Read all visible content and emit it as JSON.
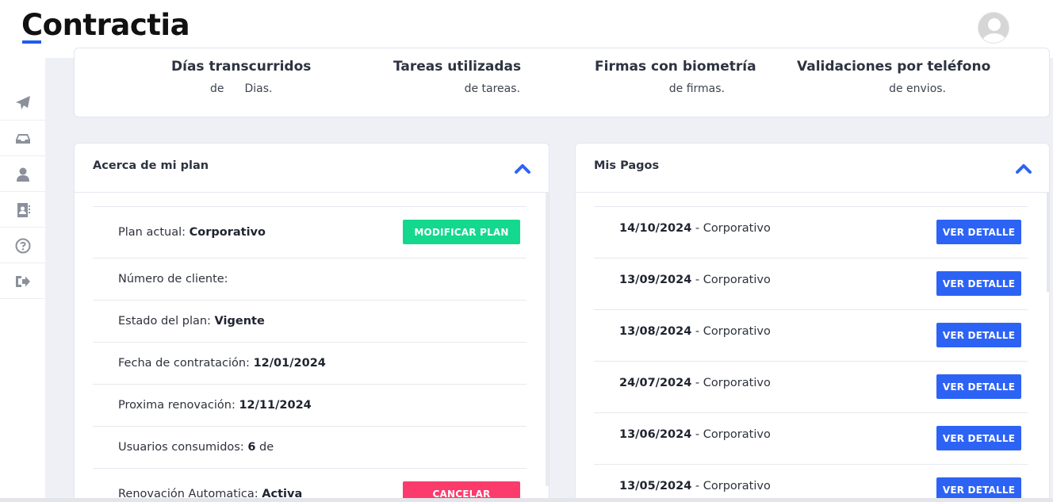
{
  "app": {
    "logo_text": "Contractia"
  },
  "sidebar": {
    "items": [
      {
        "icon": "send-icon",
        "label": ""
      },
      {
        "icon": "inbox-icon",
        "label": ""
      },
      {
        "icon": "user-icon",
        "label": ""
      },
      {
        "icon": "contacts-icon",
        "label": ""
      },
      {
        "icon": "help-icon",
        "label": ""
      },
      {
        "icon": "logout-icon",
        "label": ""
      }
    ]
  },
  "stats": [
    {
      "title": "Días transcurridos",
      "sub_prefix": "de",
      "sub_suffix": "Dias."
    },
    {
      "title": "Tareas utilizadas",
      "sub": "de tareas."
    },
    {
      "title": "Firmas con biometría",
      "sub": "de firmas."
    },
    {
      "title": "Validaciones por teléfono",
      "sub": "de envios."
    }
  ],
  "plan": {
    "title": "Acerca de mi plan",
    "rows": [
      {
        "label": "Plan actual: ",
        "value": "Corporativo"
      },
      {
        "label": "Número de cliente:",
        "value": ""
      },
      {
        "label": "Estado del plan: ",
        "value": "Vigente"
      },
      {
        "label": "Fecha de contratación: ",
        "value": "12/01/2024"
      },
      {
        "label": "Proxima renovación: ",
        "value": "12/11/2024"
      },
      {
        "label": "Usuarios consumidos: ",
        "value": "6",
        "suffix": " de"
      },
      {
        "label": "Renovación Automatica: ",
        "value": "Activa"
      }
    ],
    "modify_button": "MODIFICAR PLAN",
    "cancel_button": "CANCELAR"
  },
  "payments": {
    "title": "Mis Pagos",
    "button_label": "VER DETALLE",
    "rows": [
      {
        "date": "14/10/2024",
        "plan": " - Corporativo"
      },
      {
        "date": "13/09/2024",
        "plan": " - Corporativo"
      },
      {
        "date": "13/08/2024",
        "plan": " - Corporativo"
      },
      {
        "date": "24/07/2024",
        "plan": " - Corporativo"
      },
      {
        "date": "13/06/2024",
        "plan": " - Corporativo"
      },
      {
        "date": "13/05/2024",
        "plan": " - Corporativo"
      }
    ]
  },
  "colors": {
    "accent": "#2d63f5",
    "success": "#13d88d",
    "danger": "#fb3b6c",
    "logo_underline": "#1d5cf0"
  }
}
